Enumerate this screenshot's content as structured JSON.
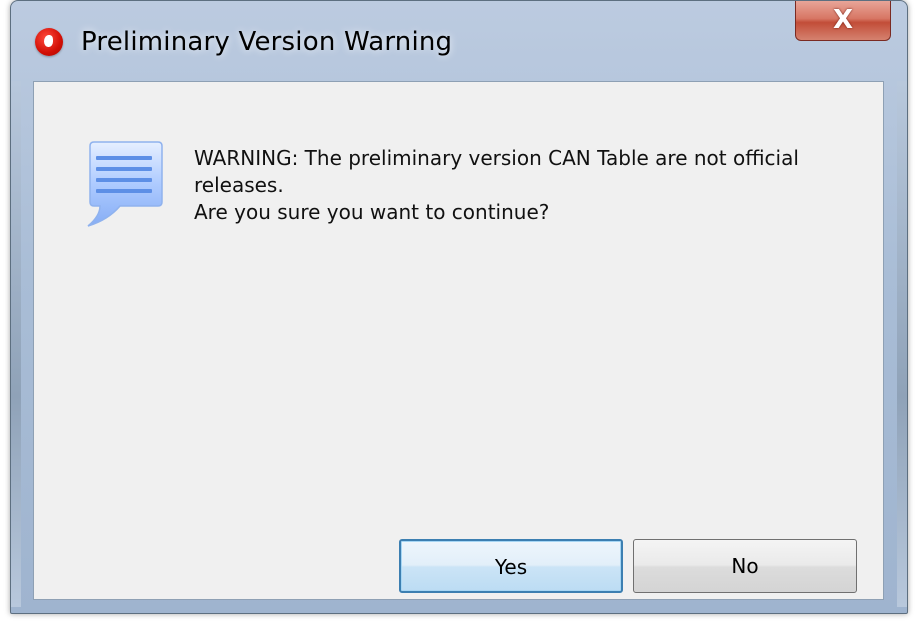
{
  "window": {
    "title": "Preliminary Version Warning",
    "app_icon": "vodafone-logo-icon",
    "close_icon": "close-icon",
    "close_glyph": "X"
  },
  "dialog": {
    "icon": "speech-bubble-icon",
    "message_lines": [
      "WARNING: The preliminary version CAN Table are not official",
      "releases.",
      "Are you sure you want to continue?"
    ]
  },
  "buttons": {
    "yes_label": "Yes",
    "no_label": "No"
  },
  "colors": {
    "title_bar": "#a9bdd6",
    "close_button": "#c24d38",
    "dialog_background": "#f0f0f0",
    "default_button_border": "#3c7fb1"
  }
}
